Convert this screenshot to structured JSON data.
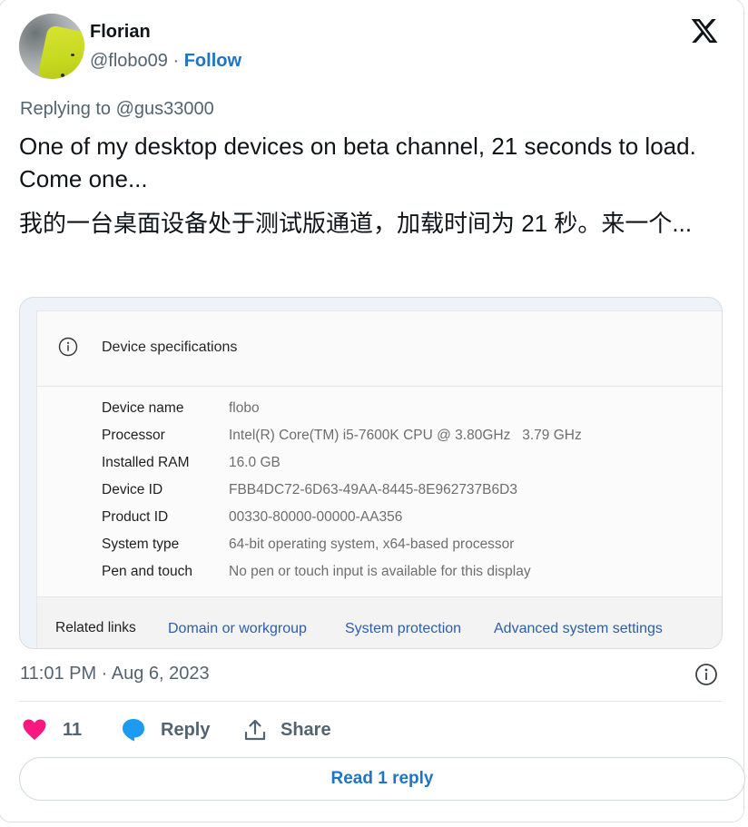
{
  "tweet": {
    "author": {
      "display_name": "Florian",
      "handle": "@flobo09",
      "separator": " · ",
      "follow_label": "Follow",
      "avatar_icon": "avatar-photo"
    },
    "platform_icon": "x-logo-icon",
    "replying_to": "Replying to @gus33000",
    "text": "One of my desktop devices on beta channel, 21 seconds to load. Come one...",
    "translation": "我的一台桌面设备处于测试版通道，加载时间为 21 秒。来一个...",
    "timestamp": "11:01 PM · Aug 6, 2023",
    "likes_count": "11",
    "reply_label": "Reply",
    "share_label": "Share",
    "read_replies_label": "Read 1 reply",
    "colors": {
      "link_blue": "#1d74c9",
      "heart_pink": "#f91880",
      "reply_blue": "#1d9bf0",
      "muted_text": "#536471"
    }
  },
  "embedded_screenshot": {
    "section_title": "Device specifications",
    "section_icon": "info-icon",
    "specs": [
      {
        "label": "Device name",
        "value": "flobo"
      },
      {
        "label": "Processor",
        "value": "Intel(R) Core(TM) i5-7600K CPU @ 3.80GHz   3.79 GHz"
      },
      {
        "label": "Installed RAM",
        "value": "16.0 GB"
      },
      {
        "label": "Device ID",
        "value": "FBB4DC72-6D63-49AA-8445-8E962737B6D3"
      },
      {
        "label": "Product ID",
        "value": "00330-80000-00000-AA356"
      },
      {
        "label": "System type",
        "value": "64-bit operating system, x64-based processor"
      },
      {
        "label": "Pen and touch",
        "value": "No pen or touch input is available for this display"
      }
    ],
    "related_links_label": "Related links",
    "related_links": [
      "Domain or workgroup",
      "System protection",
      "Advanced system settings"
    ],
    "colors": {
      "link": "#2b5fa8"
    }
  }
}
